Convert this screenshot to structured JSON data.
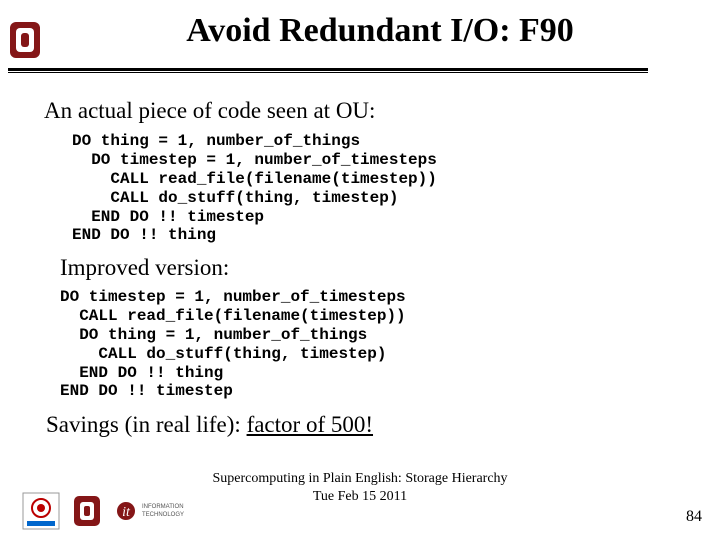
{
  "title": "Avoid Redundant I/O: F90",
  "intro": "An actual piece of code seen at OU:",
  "code1": "DO thing = 1, number_of_things\n  DO timestep = 1, number_of_timesteps\n    CALL read_file(filename(timestep))\n    CALL do_stuff(thing, timestep)\n  END DO !! timestep\nEND DO !! thing",
  "improved_label": "Improved version:",
  "code2": "DO timestep = 1, number_of_timesteps\n  CALL read_file(filename(timestep))\n  DO thing = 1, number_of_things\n    CALL do_stuff(thing, timestep)\n  END DO !! thing\nEND DO !! timestep",
  "savings_prefix": "Savings (in real life):  ",
  "savings_factor": "factor of 500!",
  "footer_line1": "Supercomputing in Plain English: Storage Hierarchy",
  "footer_line2": "Tue Feb 15 2011",
  "page_number": "84",
  "colors": {
    "ou_crimson": "#841617"
  }
}
